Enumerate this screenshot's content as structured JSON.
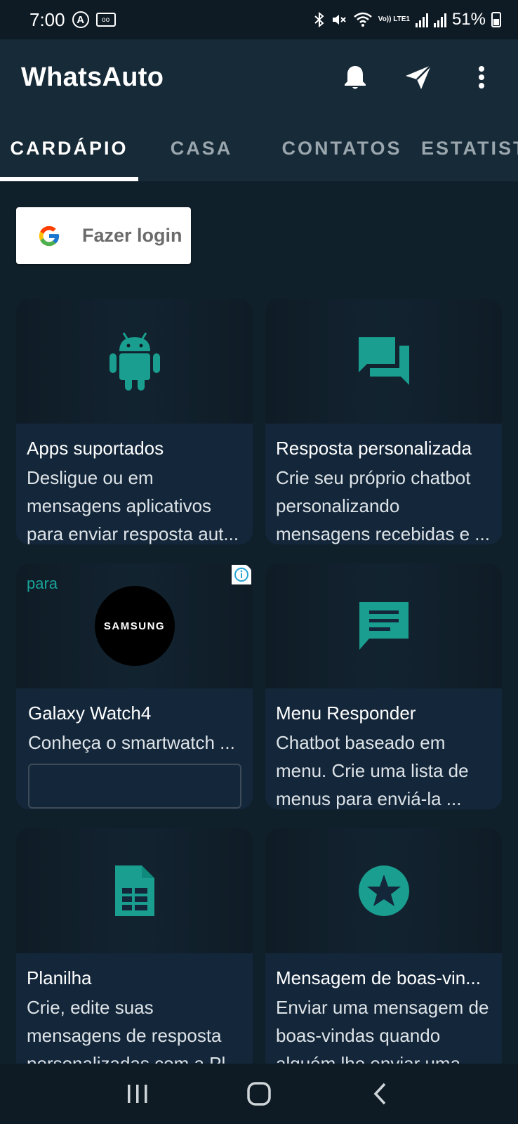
{
  "status_bar": {
    "time": "7:00",
    "battery_percent": "51%",
    "icons": [
      "auto-a-icon",
      "voicemail-icon",
      "bluetooth-icon",
      "mute-icon",
      "wifi-icon",
      "volte-icon",
      "signal-icon",
      "signal-icon",
      "battery-icon"
    ],
    "volte_text": "Vo)) LTE1"
  },
  "app_bar": {
    "title": "WhatsAuto",
    "actions": [
      "bell-icon",
      "send-icon",
      "more-vert-icon"
    ]
  },
  "tabs": [
    {
      "label": "CARDÁPIO",
      "active": true
    },
    {
      "label": "CASA",
      "active": false
    },
    {
      "label": "CONTATOS",
      "active": false
    },
    {
      "label": "ESTATIST",
      "active": false
    }
  ],
  "login": {
    "label": "Fazer login",
    "icon": "google-icon"
  },
  "cards": [
    {
      "icon": "android-icon",
      "title": "Apps suportados",
      "description": "Desligue ou em mensagens aplicativos para enviar resposta aut..."
    },
    {
      "icon": "forum-icon",
      "title": "Resposta personalizada",
      "description": "Crie seu próprio chatbot personalizando mensagens recebidas e ..."
    },
    {
      "icon": "samsung-logo",
      "is_ad": true,
      "ad_label": "para",
      "brand": "SAMSUNG",
      "title": "Galaxy Watch4",
      "description": "Conheça o smartwatch ..."
    },
    {
      "icon": "message-icon",
      "title": "Menu Responder",
      "description": "Chatbot baseado em menu. Crie uma lista de menus para enviá-la ..."
    },
    {
      "icon": "spreadsheet-icon",
      "title": "Planilha",
      "description": "Crie, edite suas mensagens de resposta personalizadas com a Pl..."
    },
    {
      "icon": "star-circle-icon",
      "title": "Mensagem de boas-vin...",
      "description": "Enviar uma mensagem de boas-vindas quando alguém lhe enviar uma ..."
    }
  ],
  "nav_bar": [
    "recents-icon",
    "home-icon",
    "back-icon"
  ],
  "colors": {
    "accent": "#1a9e8f",
    "app_bar": "#172a38",
    "background": "#10202b",
    "card": "#13263a"
  }
}
